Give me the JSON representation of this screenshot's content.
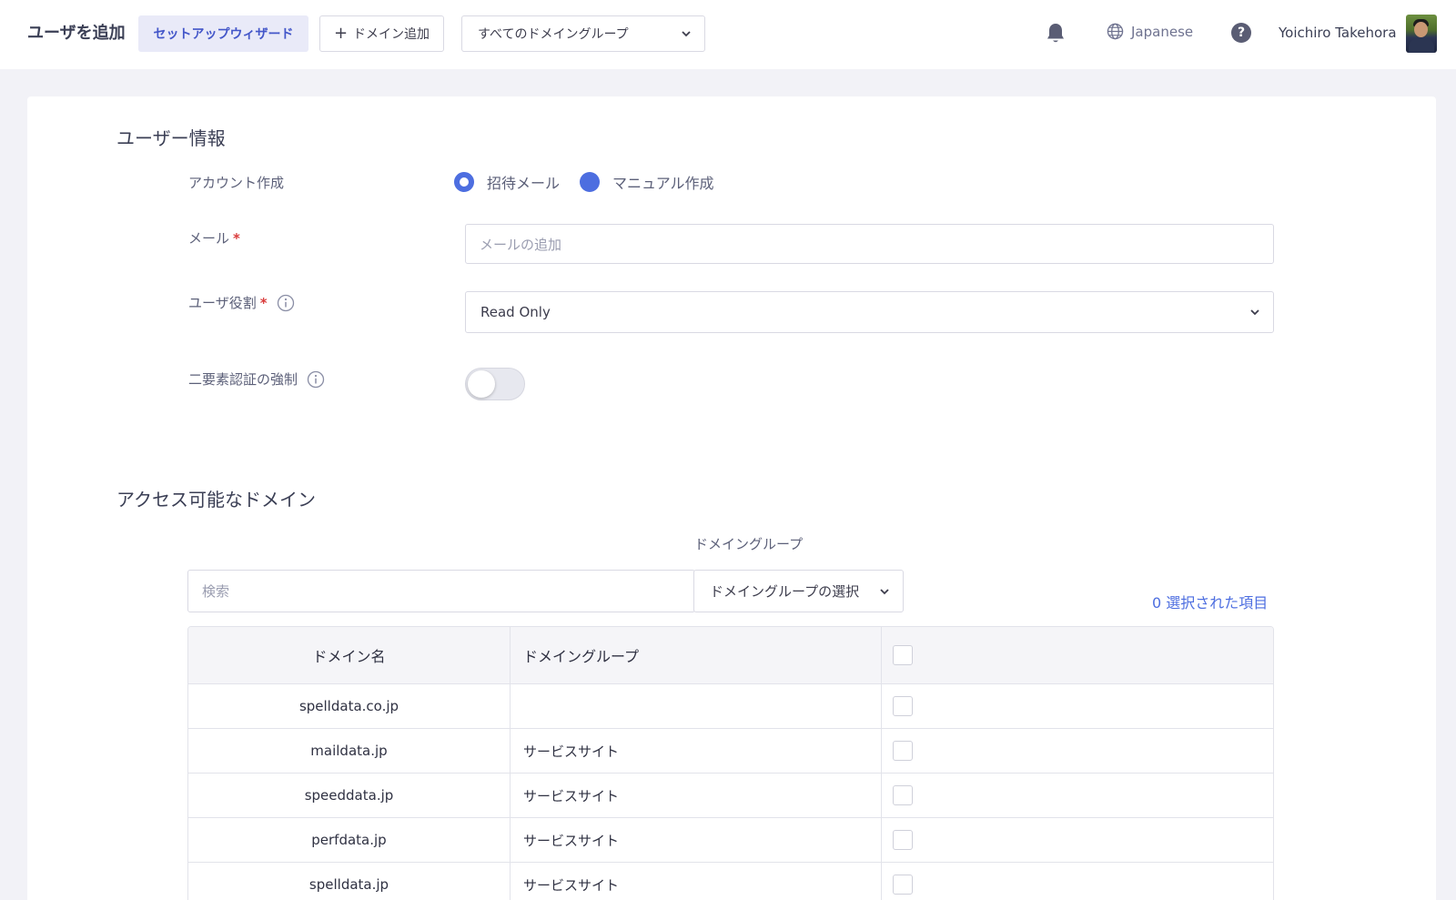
{
  "header": {
    "page_title": "ユーザを追加",
    "wizard_label": "セットアップウィザード",
    "add_domain_label": "ドメイン追加",
    "domain_group_selected": "すべてのドメイングループ",
    "language": "Japanese",
    "help_glyph": "?",
    "username": "Yoichiro Takehora"
  },
  "user_info": {
    "section_title": "ユーザー情報",
    "account_creation_label": "アカウント作成",
    "account_options": [
      "招待メール",
      "マニュアル作成"
    ],
    "email_label": "メール",
    "required_mark": "*",
    "email_placeholder": "メールの追加",
    "role_label": "ユーザ役割",
    "role_value": "Read Only",
    "tfa_label": "二要素認証の強制",
    "tfa_enabled": false
  },
  "domains": {
    "section_title": "アクセス可能なドメイン",
    "search_placeholder": "検索",
    "group_filter_label": "ドメイングループ",
    "group_filter_value": "ドメイングループの選択",
    "selected_count_text": "0 選択された項目",
    "columns": [
      "ドメイン名",
      "ドメイングループ"
    ],
    "rows": [
      {
        "name": "spelldata.co.jp",
        "group": ""
      },
      {
        "name": "maildata.jp",
        "group": "サービスサイト"
      },
      {
        "name": "speeddata.jp",
        "group": "サービスサイト"
      },
      {
        "name": "perfdata.jp",
        "group": "サービスサイト"
      },
      {
        "name": "spelldata.jp",
        "group": "サービスサイト"
      }
    ]
  },
  "colors": {
    "accent": "#4d6ee0",
    "wizard_bg": "#e9eaf8",
    "required": "#d93a3a",
    "page_bg": "#f2f2f7"
  },
  "icons": [
    "bell-icon",
    "globe-icon",
    "help-icon",
    "chevron-down-icon",
    "info-icon",
    "plus-icon"
  ]
}
